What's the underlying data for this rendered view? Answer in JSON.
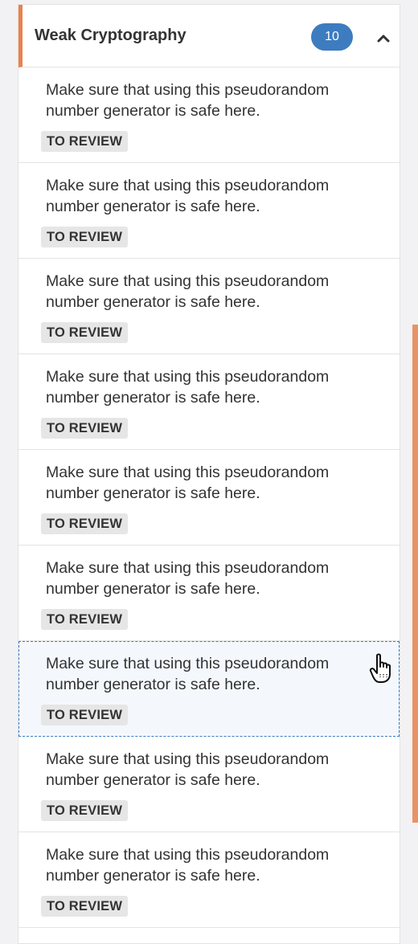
{
  "category": {
    "title": "Weak Cryptography",
    "count": "10",
    "accent_color": "#e8834d",
    "badge_color": "#3d7cbf",
    "collapse_icon": "chevron-up-icon"
  },
  "hotspots": [
    {
      "message": "Make sure that using this pseudorandom number generator is safe here.",
      "status": "TO REVIEW",
      "selected": false
    },
    {
      "message": "Make sure that using this pseudorandom number generator is safe here.",
      "status": "TO REVIEW",
      "selected": false
    },
    {
      "message": "Make sure that using this pseudorandom number generator is safe here.",
      "status": "TO REVIEW",
      "selected": false
    },
    {
      "message": "Make sure that using this pseudorandom number generator is safe here.",
      "status": "TO REVIEW",
      "selected": false
    },
    {
      "message": "Make sure that using this pseudorandom number generator is safe here.",
      "status": "TO REVIEW",
      "selected": false
    },
    {
      "message": "Make sure that using this pseudorandom number generator is safe here.",
      "status": "TO REVIEW",
      "selected": false
    },
    {
      "message": "Make sure that using this pseudorandom number generator is safe here.",
      "status": "TO REVIEW",
      "selected": true
    },
    {
      "message": "Make sure that using this pseudorandom number generator is safe here.",
      "status": "TO REVIEW",
      "selected": false
    },
    {
      "message": "Make sure that using this pseudorandom number generator is safe here.",
      "status": "TO REVIEW",
      "selected": false
    }
  ],
  "cursor_icon": "hand-pointer-icon",
  "scrollbar_color": "#e8834d"
}
